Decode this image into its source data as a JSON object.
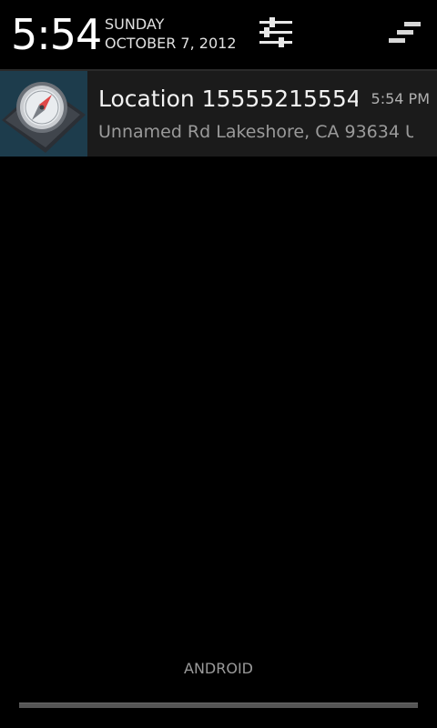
{
  "header": {
    "time": "5:54",
    "day": "SUNDAY",
    "date": "OCTOBER 7, 2012",
    "settings_icon": "quick-settings-sliders-icon",
    "clear_icon": "clear-all-notifications-icon"
  },
  "notification": {
    "icon": "compass-icon",
    "title": "Location 15555215554",
    "time": "5:54 PM",
    "text": "Unnamed Rd Lakeshore, CA 93634 U"
  },
  "footer": {
    "carrier": "ANDROID"
  },
  "colors": {
    "background": "#000000",
    "notification_bg": "#1b1b1b",
    "icon_bg": "#1d3c4c",
    "compass_needle": "#e04848"
  }
}
